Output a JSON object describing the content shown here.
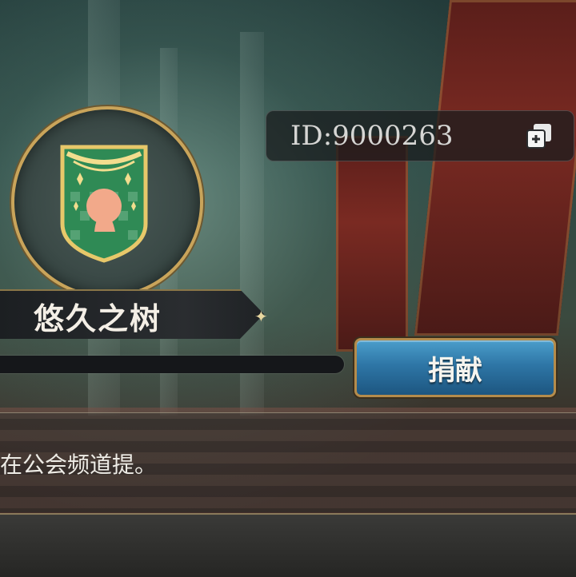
{
  "guild": {
    "name": "悠久之树",
    "id_text": "ID:9000263",
    "donate_label": "捐献",
    "hint_text": "在公会频道提。"
  },
  "icons": {
    "emblem": "guild-emblem-shield-icon",
    "copy": "copy-icon",
    "spark": "sparkle-icon"
  },
  "colors": {
    "gold_border": "#c9a45a",
    "button_blue": "#2e76a6",
    "shield_green": "#2f8a55"
  }
}
